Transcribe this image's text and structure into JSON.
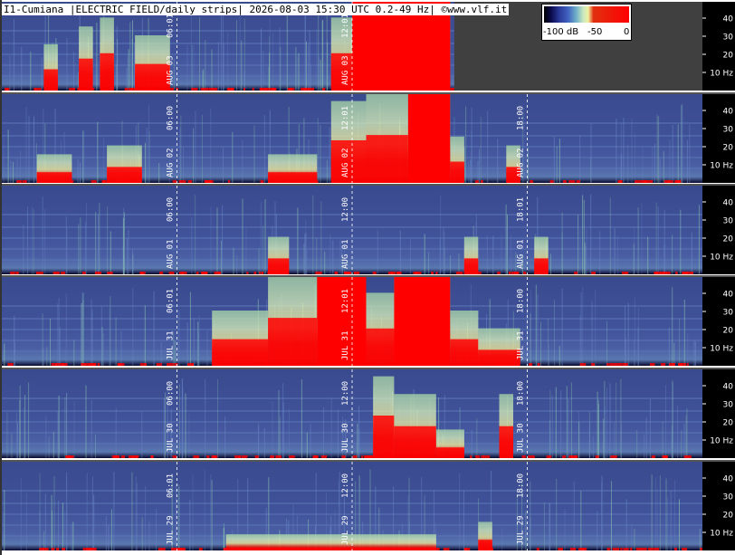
{
  "title": "I1-Cumiana |ELECTRIC FIELD/daily strips| 2026-08-03 15:30 UTC 0.2-49 Hz| ©www.vlf.it",
  "colorbar": {
    "min_label": "-100 dB",
    "mid_label": "-50",
    "max_label": "0",
    "colors": [
      "#000000",
      "#2a3a9a",
      "#4060c0",
      "#70b0c8",
      "#f0f0a0",
      "#e03010",
      "#ff0000"
    ]
  },
  "colors": {
    "background_noise": "#3d4e93",
    "saturated_event": "#ff0000",
    "band_highlight": "#a8d8a8",
    "no_data": "#404040",
    "divider": "#555555"
  },
  "chart_data": {
    "type": "heatmap",
    "title": "I1-Cumiana |ELECTRIC FIELD/daily strips| 2026-08-03 15:30 UTC 0.2-49 Hz| ©www.vlf.it",
    "y_ticks": [
      "40",
      "30",
      "20",
      "10 Hz"
    ],
    "ylim": [
      0.2,
      49
    ],
    "color_scale_db": [
      -100,
      0
    ],
    "strips": [
      {
        "date": "AUG 03",
        "time_labels": [
          "06:01",
          "AUG 03",
          "12:01",
          "AUG 03"
        ],
        "marks": [
          "AUG 03",
          "06:01",
          "AUG 03",
          "12:01"
        ],
        "data_until": "15:30",
        "events": [
          [
            0.06,
            0.08,
            0.4
          ],
          [
            0.11,
            0.13,
            0.6
          ],
          [
            0.14,
            0.16,
            0.7
          ],
          [
            0.19,
            0.24,
            0.5
          ],
          [
            0.47,
            0.5,
            0.7
          ],
          [
            0.5,
            0.52,
            1.0
          ],
          [
            0.52,
            0.64,
            1.0
          ]
        ]
      },
      {
        "date": "AUG 02",
        "marks": [
          "AUG 02",
          "06:00",
          "AUG 02",
          "12:01",
          "AUG 02",
          "18:00"
        ],
        "events": [
          [
            0.05,
            0.1,
            0.2
          ],
          [
            0.15,
            0.2,
            0.3
          ],
          [
            0.38,
            0.45,
            0.2
          ],
          [
            0.47,
            0.52,
            0.8
          ],
          [
            0.52,
            0.58,
            0.9
          ],
          [
            0.58,
            0.64,
            1.0
          ],
          [
            0.64,
            0.66,
            0.4
          ],
          [
            0.72,
            0.74,
            0.3
          ]
        ]
      },
      {
        "date": "AUG 01",
        "marks": [
          "AUG 01",
          "06:00",
          "AUG 01",
          "12:00",
          "AUG 01",
          "18:01"
        ],
        "events": [
          [
            0.38,
            0.41,
            0.3
          ],
          [
            0.66,
            0.68,
            0.3
          ],
          [
            0.76,
            0.78,
            0.3
          ]
        ]
      },
      {
        "date": "JUL 31",
        "marks": [
          "JUL 31",
          "06:01",
          "JUL 31",
          "12:01",
          "JUL 31",
          "18:00"
        ],
        "events": [
          [
            0.3,
            0.38,
            0.5
          ],
          [
            0.38,
            0.45,
            0.9
          ],
          [
            0.45,
            0.52,
            1.0
          ],
          [
            0.52,
            0.56,
            0.7
          ],
          [
            0.56,
            0.64,
            1.0
          ],
          [
            0.64,
            0.68,
            0.5
          ],
          [
            0.68,
            0.74,
            0.3
          ]
        ]
      },
      {
        "date": "JUL 30",
        "marks": [
          "JUL 30",
          "06:00",
          "JUL 30",
          "12:00",
          "JUL 30",
          "18:00"
        ],
        "events": [
          [
            0.53,
            0.56,
            0.8
          ],
          [
            0.56,
            0.62,
            0.6
          ],
          [
            0.62,
            0.66,
            0.2
          ],
          [
            0.71,
            0.73,
            0.6
          ]
        ]
      },
      {
        "date": "JUL 29",
        "marks": [
          "JUL 29",
          "06:01",
          "JUL 29",
          "12:00",
          "JUL 29",
          "18:00"
        ],
        "events": [
          [
            0.32,
            0.62,
            0.06
          ],
          [
            0.68,
            0.7,
            0.2
          ]
        ]
      }
    ]
  }
}
